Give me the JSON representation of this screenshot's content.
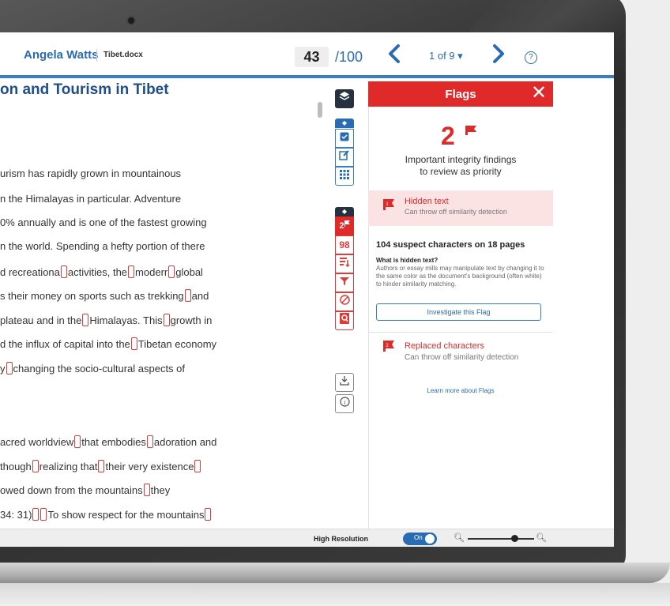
{
  "header": {
    "author": "Angela Watts",
    "file_name": "Tibet.docx",
    "current_page": "43",
    "total_pages": "/100",
    "match_selector": "1 of 9 ▾",
    "nav_prev": "‹",
    "nav_next": "›",
    "help": "?"
  },
  "document": {
    "title": "on and Tourism in Tibet",
    "lines": [
      [
        "urism has rapidly grown in mountainous"
      ],
      [
        "n the Himalayas in particular. Adventure"
      ],
      [
        "0% annually and is one of the fastest growing"
      ],
      [
        "n the world. Spending a hefty portion of there"
      ],
      [
        "d recreationa",
        "activities, the",
        "moderr",
        "global"
      ],
      [
        "s their money on sports such as trekking",
        "and"
      ],
      [
        " plateau and in the",
        "Himalayas. This",
        "growth in"
      ],
      [
        "d the influx of capital into the",
        "Tibetan economy"
      ],
      [
        "y",
        "changing the socio-cultural aspects of"
      ],
      [
        "acred worldview",
        "that embodies",
        "adoration and"
      ],
      [
        "though",
        "realizing that",
        "their very existence",
        ""
      ],
      [
        "owed down from the mountains",
        "they"
      ],
      [
        "34: 31)",
        "",
        "To show respect for the mountains",
        ""
      ]
    ]
  },
  "toolbar": {
    "layers_icon": "layers-icon",
    "match_overview_count": "",
    "flag_count": "2",
    "similarity_score": "98"
  },
  "flags_panel": {
    "title": "Flags",
    "close": "✕",
    "count": "2",
    "priority_text": "Important integrity findings\nto review as priority",
    "flags": [
      {
        "name": "Hidden text",
        "description": "Can throw off similarity detection",
        "number": "1"
      },
      {
        "name": "Replaced characters",
        "description": "Can throw off similarity detection",
        "number": "2"
      }
    ],
    "suspect_summary": "104 suspect characters on 18 pages",
    "what_heading": "What is hidden text?",
    "what_body": "Authors or essay mills may manipulate text by changing it to the same color as the document's background (often white) to hinder similarity matching.",
    "investigate_label": "Investigate this Flag",
    "learn_more": "Learn more about Flags",
    "accent_color": "#e02a2a"
  },
  "bottom_bar": {
    "high_resolution_label": "High Resolution",
    "toggle_label": "On",
    "zoom_level": 0.7
  }
}
